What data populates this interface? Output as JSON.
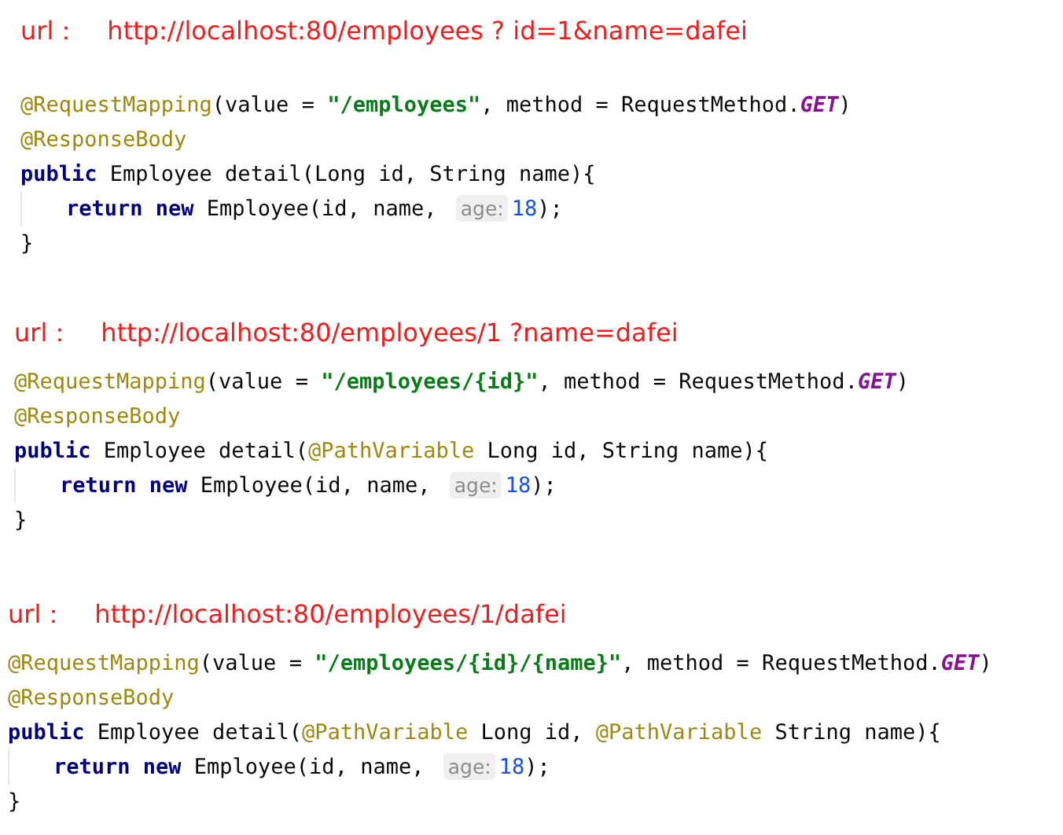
{
  "sections": [
    {
      "url_label": "url：",
      "url": "http://localhost:80/employees ? id=1&name=dafei",
      "code": [
        {
          "indented": false,
          "tokens": [
            {
              "kind": "annotation",
              "text": "@RequestMapping"
            },
            {
              "kind": "plain",
              "text": "(value = "
            },
            {
              "kind": "string",
              "text": "\"/employees\""
            },
            {
              "kind": "plain",
              "text": ", method = RequestMethod."
            },
            {
              "kind": "constant",
              "text": "GET"
            },
            {
              "kind": "plain",
              "text": ")"
            }
          ]
        },
        {
          "indented": false,
          "tokens": [
            {
              "kind": "annotation",
              "text": "@ResponseBody"
            }
          ]
        },
        {
          "indented": false,
          "tokens": [
            {
              "kind": "keyword",
              "text": "public"
            },
            {
              "kind": "plain",
              "text": " Employee detail(Long id, String name){"
            }
          ]
        },
        {
          "indented": true,
          "tokens": [
            {
              "kind": "keyword",
              "text": "return new"
            },
            {
              "kind": "plain",
              "text": " Employee(id, name, "
            },
            {
              "kind": "hint",
              "text": "age:"
            },
            {
              "kind": "number",
              "text": "18"
            },
            {
              "kind": "plain",
              "text": ");"
            }
          ]
        },
        {
          "indented": false,
          "tokens": [
            {
              "kind": "plain",
              "text": "}"
            }
          ]
        }
      ]
    },
    {
      "url_label": "url：",
      "url": "http://localhost:80/employees/1 ?name=dafei",
      "code": [
        {
          "indented": false,
          "tokens": [
            {
              "kind": "annotation",
              "text": "@RequestMapping"
            },
            {
              "kind": "plain",
              "text": "(value = "
            },
            {
              "kind": "string",
              "text": "\"/employees/{id}\""
            },
            {
              "kind": "plain",
              "text": ", method = RequestMethod."
            },
            {
              "kind": "constant",
              "text": "GET"
            },
            {
              "kind": "plain",
              "text": ")"
            }
          ]
        },
        {
          "indented": false,
          "tokens": [
            {
              "kind": "annotation",
              "text": "@ResponseBody"
            }
          ]
        },
        {
          "indented": false,
          "tokens": [
            {
              "kind": "keyword",
              "text": "public"
            },
            {
              "kind": "plain",
              "text": " Employee detail("
            },
            {
              "kind": "annotation",
              "text": "@PathVariable"
            },
            {
              "kind": "plain",
              "text": " Long id, String name){"
            }
          ]
        },
        {
          "indented": true,
          "tokens": [
            {
              "kind": "keyword",
              "text": "return new"
            },
            {
              "kind": "plain",
              "text": " Employee(id, name, "
            },
            {
              "kind": "hint",
              "text": "age:"
            },
            {
              "kind": "number",
              "text": "18"
            },
            {
              "kind": "plain",
              "text": ");"
            }
          ]
        },
        {
          "indented": false,
          "tokens": [
            {
              "kind": "plain",
              "text": "}"
            }
          ]
        }
      ]
    },
    {
      "url_label": "url：",
      "url": "http://localhost:80/employees/1/dafei",
      "code": [
        {
          "indented": false,
          "tokens": [
            {
              "kind": "annotation",
              "text": "@RequestMapping"
            },
            {
              "kind": "plain",
              "text": "(value = "
            },
            {
              "kind": "string",
              "text": "\"/employees/{id}/{name}\""
            },
            {
              "kind": "plain",
              "text": ", method = RequestMethod."
            },
            {
              "kind": "constant",
              "text": "GET"
            },
            {
              "kind": "plain",
              "text": ")"
            }
          ]
        },
        {
          "indented": false,
          "tokens": [
            {
              "kind": "annotation",
              "text": "@ResponseBody"
            }
          ]
        },
        {
          "indented": false,
          "tokens": [
            {
              "kind": "keyword",
              "text": "public"
            },
            {
              "kind": "plain",
              "text": " Employee detail("
            },
            {
              "kind": "annotation",
              "text": "@PathVariable"
            },
            {
              "kind": "plain",
              "text": " Long id, "
            },
            {
              "kind": "annotation",
              "text": "@PathVariable"
            },
            {
              "kind": "plain",
              "text": " String name){"
            }
          ]
        },
        {
          "indented": true,
          "tokens": [
            {
              "kind": "keyword",
              "text": "return new"
            },
            {
              "kind": "plain",
              "text": " Employee(id, name, "
            },
            {
              "kind": "hint",
              "text": "age:"
            },
            {
              "kind": "number",
              "text": "18"
            },
            {
              "kind": "plain",
              "text": ");"
            }
          ]
        },
        {
          "indented": false,
          "tokens": [
            {
              "kind": "plain",
              "text": "}"
            }
          ]
        }
      ]
    }
  ]
}
